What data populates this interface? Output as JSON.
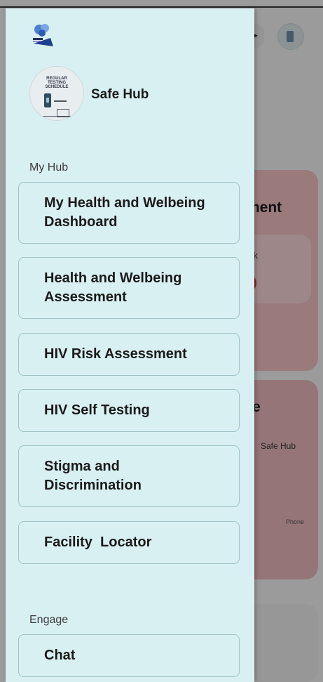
{
  "background": {
    "card1": {
      "back": "<",
      "title": "ment",
      "text": "sk"
    },
    "card2": {
      "title": "e",
      "label": "Safe Hub",
      "phone": "Phone"
    }
  },
  "drawer": {
    "profile": {
      "name": "Safe Hub",
      "poster_text": "REGULAR TESTING SCHEDULE"
    },
    "sections": {
      "hub": "My Hub",
      "engage": "Engage"
    },
    "items": [
      {
        "label": "My Health and Welbeing Dashboard"
      },
      {
        "label": "Health and Welbeing Assessment"
      },
      {
        "label": "HIV Risk Assessment"
      },
      {
        "label": "HIV Self Testing"
      },
      {
        "label": "Stigma and Discrimination"
      },
      {
        "label": "Facility  Locator"
      },
      {
        "label": "Chat"
      }
    ]
  }
}
